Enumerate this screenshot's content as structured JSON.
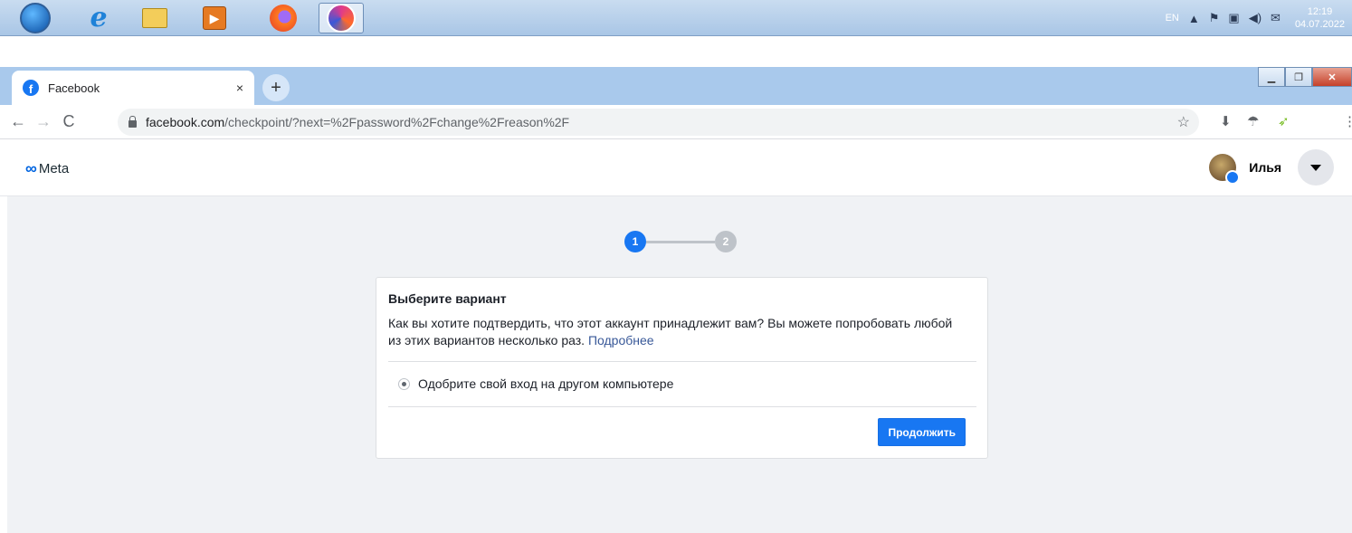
{
  "taskbar": {
    "apps": [
      {
        "icon": "windows-start-icon"
      },
      {
        "icon": "internet-explorer-icon"
      },
      {
        "icon": "file-explorer-icon"
      },
      {
        "icon": "media-player-icon"
      },
      {
        "icon": "firefox-icon"
      },
      {
        "icon": "swirl-browser-icon"
      }
    ],
    "language": "EN",
    "time": "12:19",
    "date": "04.07.2022"
  },
  "browser": {
    "tab_title": "Facebook",
    "tab_close": "×",
    "new_tab": "+",
    "url_host": "facebook.com",
    "url_path": "/checkpoint/?next=%2Fpassword%2Fchange%2Freason%2F"
  },
  "header": {
    "logo_text": "Meta",
    "user_name": "Илья"
  },
  "stepper": {
    "step1": "1",
    "step2": "2",
    "current": 1
  },
  "card": {
    "title": "Выберите вариант",
    "description": "Как вы хотите подтвердить, что этот аккаунт принадлежит вам? Вы можете попробовать любой из этих вариантов несколько раз.",
    "learn_more": "Подробнее",
    "option_label": "Одобрите свой вход на другом компьютере",
    "continue_label": "Продолжить"
  },
  "colors": {
    "accent": "#1877f2",
    "page_bg": "#f0f2f5",
    "link": "#385898"
  }
}
